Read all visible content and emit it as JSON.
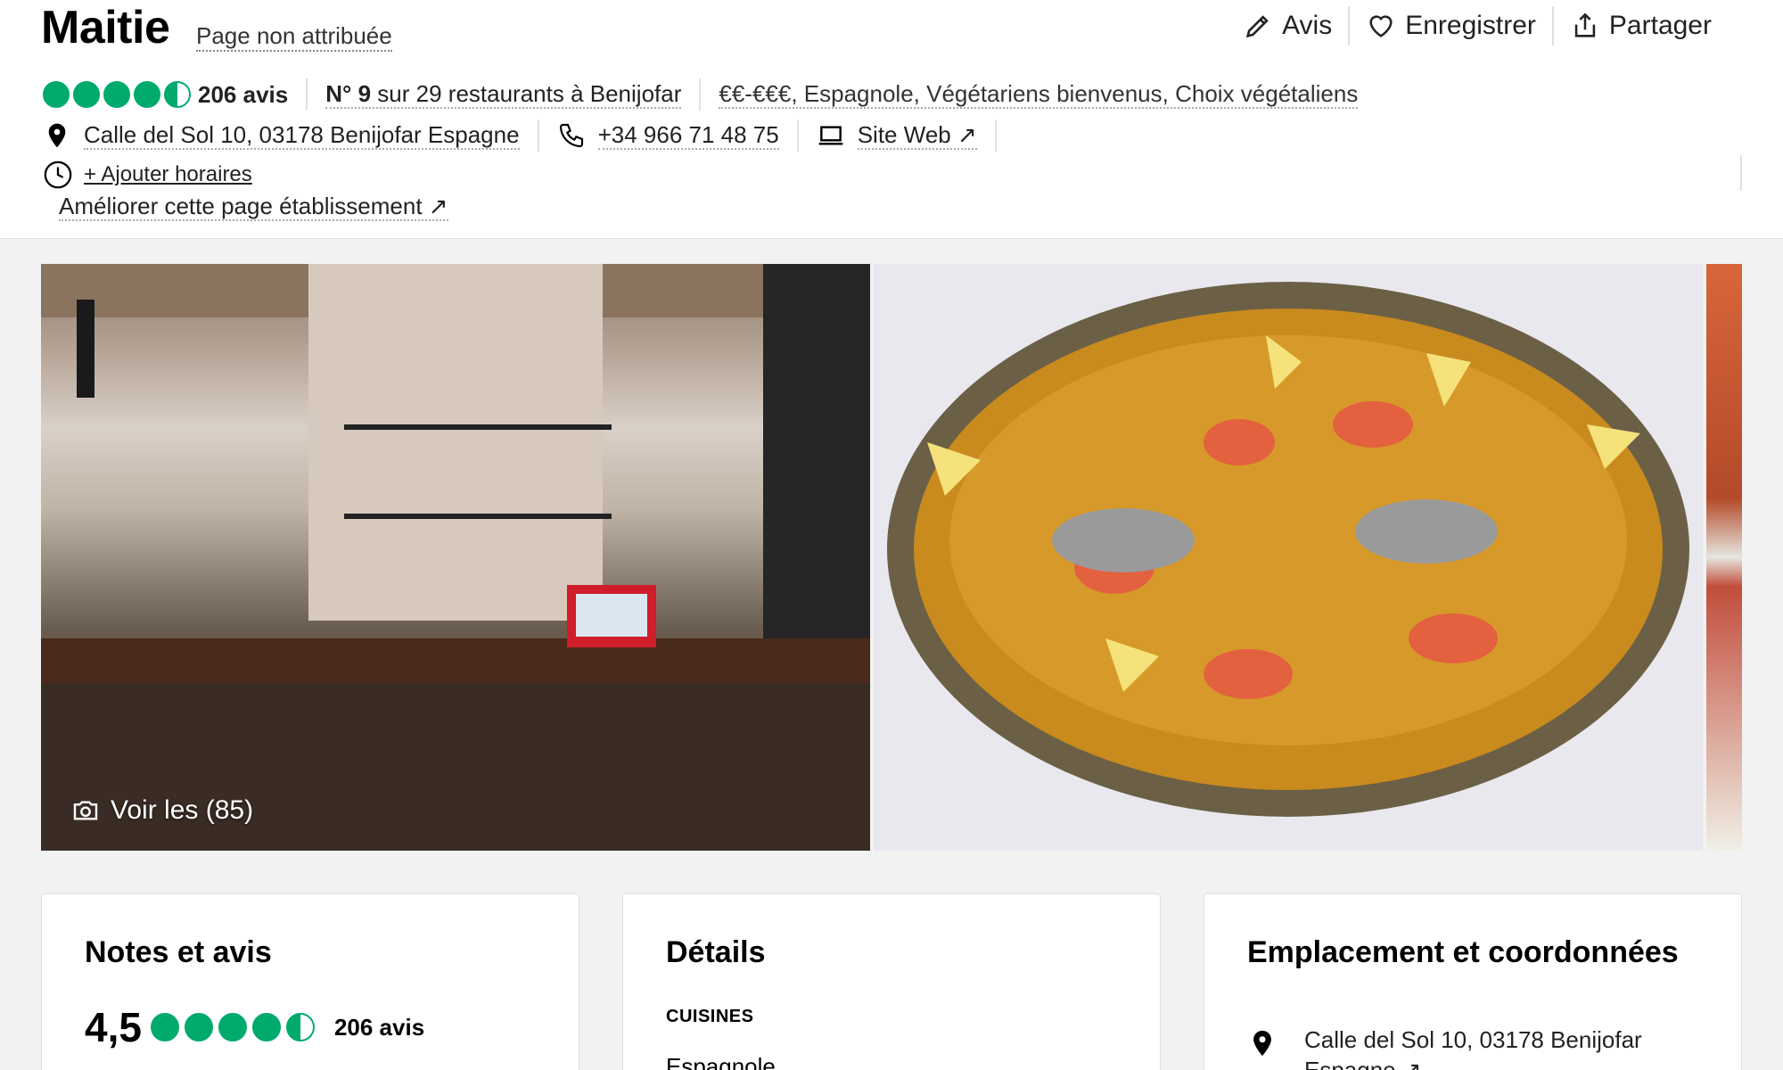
{
  "restaurant": {
    "name": "Maitie",
    "unclaimed_label": "Page non attribuée"
  },
  "actions": {
    "review_label": "Avis",
    "save_label": "Enregistrer",
    "share_label": "Partager"
  },
  "summary": {
    "rating": 4.5,
    "reviews_label": "206 avis",
    "rank_number": "N° 9",
    "rank_text": " sur 29 restaurants à Benijofar",
    "price": "€€-€€€",
    "tags": ", Espagnole, Végétariens bienvenus, Choix végétaliens"
  },
  "contact": {
    "address": "Calle del Sol 10, 03178 Benijofar Espagne",
    "phone": "+34 966 71 48 75",
    "website_label": "Site Web ↗",
    "add_hours_label": "+ Ajouter horaires",
    "improve_label": "Améliorer cette page établissement ↗"
  },
  "gallery": {
    "see_all_label": "Voir les (85)"
  },
  "cards": {
    "ratings": {
      "title": "Notes et avis",
      "score": "4,5",
      "reviews_label": "206 avis"
    },
    "details": {
      "title": "Détails",
      "cuisines_label": "CUISINES",
      "cuisines_value": "Espagnole"
    },
    "location": {
      "title": "Emplacement et coordonnées",
      "address_line1": "Calle del Sol 10, 03178 Benijofar",
      "address_line2": "Espagne ↗"
    }
  },
  "colors": {
    "bubble_green": "#00aa6c",
    "page_bg": "#f2f2f2"
  }
}
